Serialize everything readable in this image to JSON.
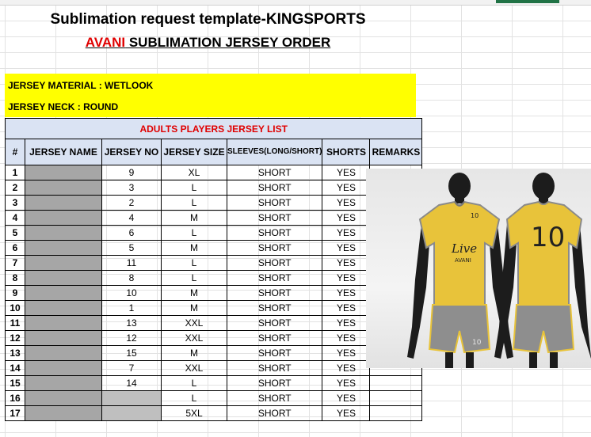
{
  "title": "Sublimation request template-KINGSPORTS",
  "subtitle_brand": "AVANI",
  "subtitle_rest": " SUBLIMATION JERSEY ORDER",
  "material": "JERSEY MATERIAL : WETLOOK",
  "neck": "JERSEY NECK : ROUND",
  "list_title": "ADULTS  PLAYERS JERSEY LIST",
  "columns": [
    "#",
    "JERSEY NAME",
    "JERSEY NO",
    "JERSEY SIZE",
    "SLEEVES(LONG/SHORT)",
    "SHORTS",
    "REMARKS"
  ],
  "rows": [
    {
      "num": "1",
      "no": "9",
      "size": "XL",
      "sleeves": "SHORT",
      "shorts": "YES"
    },
    {
      "num": "2",
      "no": "3",
      "size": "L",
      "sleeves": "SHORT",
      "shorts": "YES"
    },
    {
      "num": "3",
      "no": "2",
      "size": "L",
      "sleeves": "SHORT",
      "shorts": "YES"
    },
    {
      "num": "4",
      "no": "4",
      "size": "M",
      "sleeves": "SHORT",
      "shorts": "YES"
    },
    {
      "num": "5",
      "no": "6",
      "size": "L",
      "sleeves": "SHORT",
      "shorts": "YES"
    },
    {
      "num": "6",
      "no": "5",
      "size": "M",
      "sleeves": "SHORT",
      "shorts": "YES"
    },
    {
      "num": "7",
      "no": "11",
      "size": "L",
      "sleeves": "SHORT",
      "shorts": "YES"
    },
    {
      "num": "8",
      "no": "8",
      "size": "L",
      "sleeves": "SHORT",
      "shorts": "YES"
    },
    {
      "num": "9",
      "no": "10",
      "size": "M",
      "sleeves": "SHORT",
      "shorts": "YES"
    },
    {
      "num": "10",
      "no": "1",
      "size": "M",
      "sleeves": "SHORT",
      "shorts": "YES"
    },
    {
      "num": "11",
      "no": "13",
      "size": "XXL",
      "sleeves": "SHORT",
      "shorts": "YES"
    },
    {
      "num": "12",
      "no": "12",
      "size": "XXL",
      "sleeves": "SHORT",
      "shorts": "YES"
    },
    {
      "num": "13",
      "no": "15",
      "size": "M",
      "sleeves": "SHORT",
      "shorts": "YES"
    },
    {
      "num": "14",
      "no": "7",
      "size": "XXL",
      "sleeves": "SHORT",
      "shorts": "YES"
    },
    {
      "num": "15",
      "no": "14",
      "size": "L",
      "sleeves": "SHORT",
      "shorts": "YES"
    },
    {
      "num": "16",
      "no": "",
      "size": "L",
      "sleeves": "SHORT",
      "shorts": "YES",
      "gray_no": true
    },
    {
      "num": "17",
      "no": "",
      "size": "5XL",
      "sleeves": "SHORT",
      "shorts": "YES",
      "gray_no": true
    }
  ],
  "mockup": {
    "front_logo_line1": "Live",
    "front_logo_line2": "AVANI",
    "front_chest_number": "10",
    "back_number": "10",
    "shorts_number": "10",
    "jersey_color": "#e8c33a",
    "trim_color": "#8a8a8a",
    "shorts_color": "#8e8e8e"
  }
}
